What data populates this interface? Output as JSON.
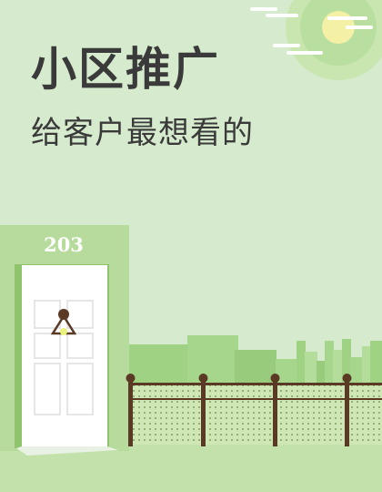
{
  "title": "小区推广",
  "subtitle": "给客户最想看的",
  "door": {
    "number": "203"
  },
  "colors": {
    "background": "#d6ebcd",
    "sun": "#f4f0a6",
    "sun_halo": "#c2e3a8",
    "door_frame": "#b4d997",
    "door_panel": "#ffffff",
    "fence_post": "#5a3a25",
    "mesh": "#cfe6b5",
    "ground": "#bfe1a6",
    "text": "#3a3a3a"
  }
}
